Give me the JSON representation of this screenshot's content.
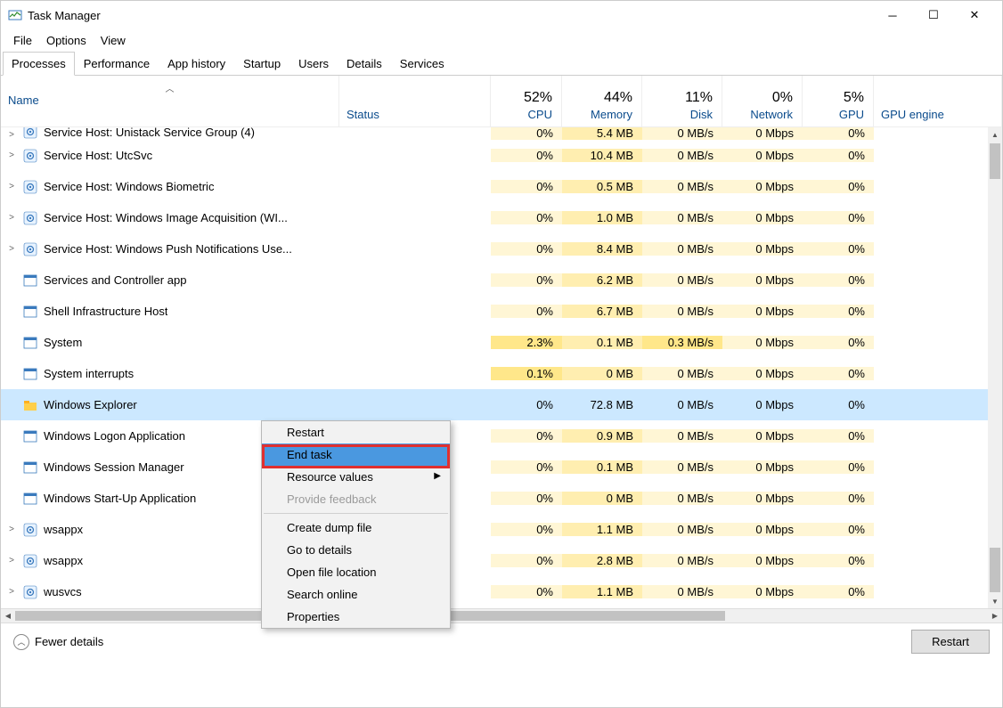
{
  "window": {
    "title": "Task Manager"
  },
  "menu": [
    "File",
    "Options",
    "View"
  ],
  "tabs": [
    "Processes",
    "Performance",
    "App history",
    "Startup",
    "Users",
    "Details",
    "Services"
  ],
  "active_tab": 0,
  "columns": {
    "name": "Name",
    "status": "Status",
    "cpu": {
      "value": "52%",
      "label": "CPU"
    },
    "mem": {
      "value": "44%",
      "label": "Memory"
    },
    "disk": {
      "value": "11%",
      "label": "Disk"
    },
    "net": {
      "value": "0%",
      "label": "Network"
    },
    "gpu": {
      "value": "5%",
      "label": "GPU"
    },
    "engine": "GPU engine"
  },
  "rows": [
    {
      "exp": true,
      "icon": "gear",
      "name": "Service Host: Unistack Service Group (4)",
      "cpu": "0%",
      "mem": "5.4 MB",
      "disk": "0 MB/s",
      "net": "0 Mbps",
      "gpu": "0%",
      "cut": true
    },
    {
      "exp": true,
      "icon": "gear",
      "name": "Service Host: UtcSvc",
      "cpu": "0%",
      "mem": "10.4 MB",
      "disk": "0 MB/s",
      "net": "0 Mbps",
      "gpu": "0%"
    },
    {
      "exp": true,
      "icon": "gear",
      "name": "Service Host: Windows Biometric",
      "cpu": "0%",
      "mem": "0.5 MB",
      "disk": "0 MB/s",
      "net": "0 Mbps",
      "gpu": "0%"
    },
    {
      "exp": true,
      "icon": "gear",
      "name": "Service Host: Windows Image Acquisition (WI...",
      "cpu": "0%",
      "mem": "1.0 MB",
      "disk": "0 MB/s",
      "net": "0 Mbps",
      "gpu": "0%"
    },
    {
      "exp": true,
      "icon": "gear",
      "name": "Service Host: Windows Push Notifications Use...",
      "cpu": "0%",
      "mem": "8.4 MB",
      "disk": "0 MB/s",
      "net": "0 Mbps",
      "gpu": "0%"
    },
    {
      "exp": false,
      "icon": "app",
      "name": "Services and Controller app",
      "cpu": "0%",
      "mem": "6.2 MB",
      "disk": "0 MB/s",
      "net": "0 Mbps",
      "gpu": "0%"
    },
    {
      "exp": false,
      "icon": "app",
      "name": "Shell Infrastructure Host",
      "cpu": "0%",
      "mem": "6.7 MB",
      "disk": "0 MB/s",
      "net": "0 Mbps",
      "gpu": "0%"
    },
    {
      "exp": false,
      "icon": "app",
      "name": "System",
      "cpu": "2.3%",
      "mem": "0.1 MB",
      "disk": "0.3 MB/s",
      "net": "0 Mbps",
      "gpu": "0%",
      "cpu_heat": "h2",
      "disk_heat": "h2"
    },
    {
      "exp": false,
      "icon": "app",
      "name": "System interrupts",
      "cpu": "0.1%",
      "mem": "0 MB",
      "disk": "0 MB/s",
      "net": "0 Mbps",
      "gpu": "0%",
      "cpu_heat": "h2"
    },
    {
      "exp": false,
      "icon": "explorer",
      "name": "Windows Explorer",
      "cpu": "0%",
      "mem": "72.8 MB",
      "disk": "0 MB/s",
      "net": "0 Mbps",
      "gpu": "0%",
      "selected": true,
      "mem_heat": "h3"
    },
    {
      "exp": false,
      "icon": "app",
      "name": "Windows Logon Application",
      "cpu": "0%",
      "mem": "0.9 MB",
      "disk": "0 MB/s",
      "net": "0 Mbps",
      "gpu": "0%"
    },
    {
      "exp": false,
      "icon": "app",
      "name": "Windows Session Manager",
      "cpu": "0%",
      "mem": "0.1 MB",
      "disk": "0 MB/s",
      "net": "0 Mbps",
      "gpu": "0%"
    },
    {
      "exp": false,
      "icon": "app",
      "name": "Windows Start-Up Application",
      "cpu": "0%",
      "mem": "0 MB",
      "disk": "0 MB/s",
      "net": "0 Mbps",
      "gpu": "0%"
    },
    {
      "exp": true,
      "icon": "gear",
      "name": "wsappx",
      "cpu": "0%",
      "mem": "1.1 MB",
      "disk": "0 MB/s",
      "net": "0 Mbps",
      "gpu": "0%"
    },
    {
      "exp": true,
      "icon": "gear",
      "name": "wsappx",
      "cpu": "0%",
      "mem": "2.8 MB",
      "disk": "0 MB/s",
      "net": "0 Mbps",
      "gpu": "0%"
    },
    {
      "exp": true,
      "icon": "gear",
      "name": "wusvcs",
      "cpu": "0%",
      "mem": "1.1 MB",
      "disk": "0 MB/s",
      "net": "0 Mbps",
      "gpu": "0%"
    }
  ],
  "context_menu": {
    "items": [
      {
        "label": "Restart"
      },
      {
        "label": "End task",
        "highlight": true
      },
      {
        "label": "Resource values",
        "submenu": true
      },
      {
        "label": "Provide feedback",
        "disabled": true
      },
      {
        "sep": true
      },
      {
        "label": "Create dump file"
      },
      {
        "label": "Go to details"
      },
      {
        "label": "Open file location"
      },
      {
        "label": "Search online"
      },
      {
        "label": "Properties"
      }
    ]
  },
  "footer": {
    "fewer": "Fewer details",
    "button": "Restart"
  }
}
